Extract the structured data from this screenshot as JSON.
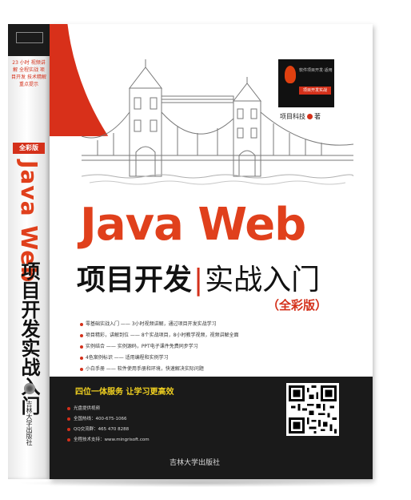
{
  "spine": {
    "blurb": "23 小时 视频讲解 全程实战 项目开发 技术精解 重点提示",
    "badge": "全彩版",
    "title": "Java Web",
    "subtitle": "项目开发实战入门",
    "publisher": "吉林大学出版社"
  },
  "cover": {
    "logo_line1": "软件项目开发·适用",
    "logo_line2": "项目开发实战",
    "author": "项目科技",
    "author_suffix": "著",
    "title": "Java Web",
    "subtitle_bold": "项目开发",
    "subtitle_sep": "|",
    "subtitle_light": "实战入门",
    "edition": "（全彩版）",
    "features": [
      "零基础实战入门 —— 3小时视频讲解，通过项目开发实战学习",
      "项目精彩，讲解到位 —— 8个实战项目，8小时教学视频，视频讲解全面",
      "实例结合 —— 实例源码，PPT电子课件免费同步学习",
      "4色案例标识 —— 适用编程和实例学习",
      "小白手册 —— 软件使用手册和环境，快速解决实际问题"
    ],
    "slogan": "四位一体服务  让学习更高效",
    "services": [
      "光盘提供视频",
      "全国热线：400-675-1066",
      "QQ交流群：465 470 8288",
      "全程技术支持：www.mingrisoft.com"
    ],
    "publisher": "吉林大学出版社"
  },
  "colors": {
    "accent": "#e0401c",
    "dark": "#1a1a1a",
    "slogan": "#f0d020"
  }
}
